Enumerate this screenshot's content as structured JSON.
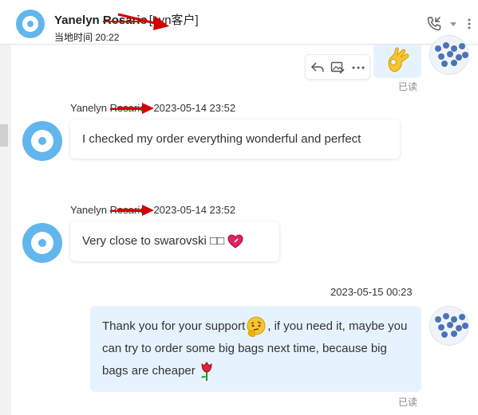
{
  "header": {
    "contact_name": "Yanelyn",
    "contact_surname_struck": "Rosario",
    "contact_tag": "[Lyn客户]",
    "local_time_label": "当地时间 20:22"
  },
  "messages": [
    {
      "sender_first": "Yanelyn",
      "sender_struck": "Rosario",
      "timestamp": "2023-05-14 23:52",
      "text": "I checked my order everything wonderful and perfect"
    },
    {
      "sender_first": "Yanelyn",
      "sender_struck": "Rosario",
      "timestamp": "2023-05-14 23:52",
      "text": "Very close to swarovski □□"
    }
  ],
  "outgoing": {
    "timestamp": "2023-05-15 00:23",
    "text_part1": "Thank you for your support",
    "text_part2": ", if you need it, maybe you can try to order some big bags next time, because big bags are cheaper",
    "read_label": "已读"
  },
  "top_read_label": "已读",
  "icons": {
    "call": "phone-call-icon",
    "dropdown": "chevron-down-icon",
    "reply": "reply-icon",
    "image_edit": "image-edit-icon",
    "more": "more-dots-icon",
    "ok_hand": "ok-hand-emoji-icon",
    "thinking": "thinking-face-emoji-icon",
    "heart": "heart-emoji-icon",
    "rose": "rose-emoji-icon"
  },
  "colors": {
    "app_avatar": "#62b6ee",
    "outgoing_bubble": "#e6f3ff",
    "annotation_red": "#d40000"
  }
}
